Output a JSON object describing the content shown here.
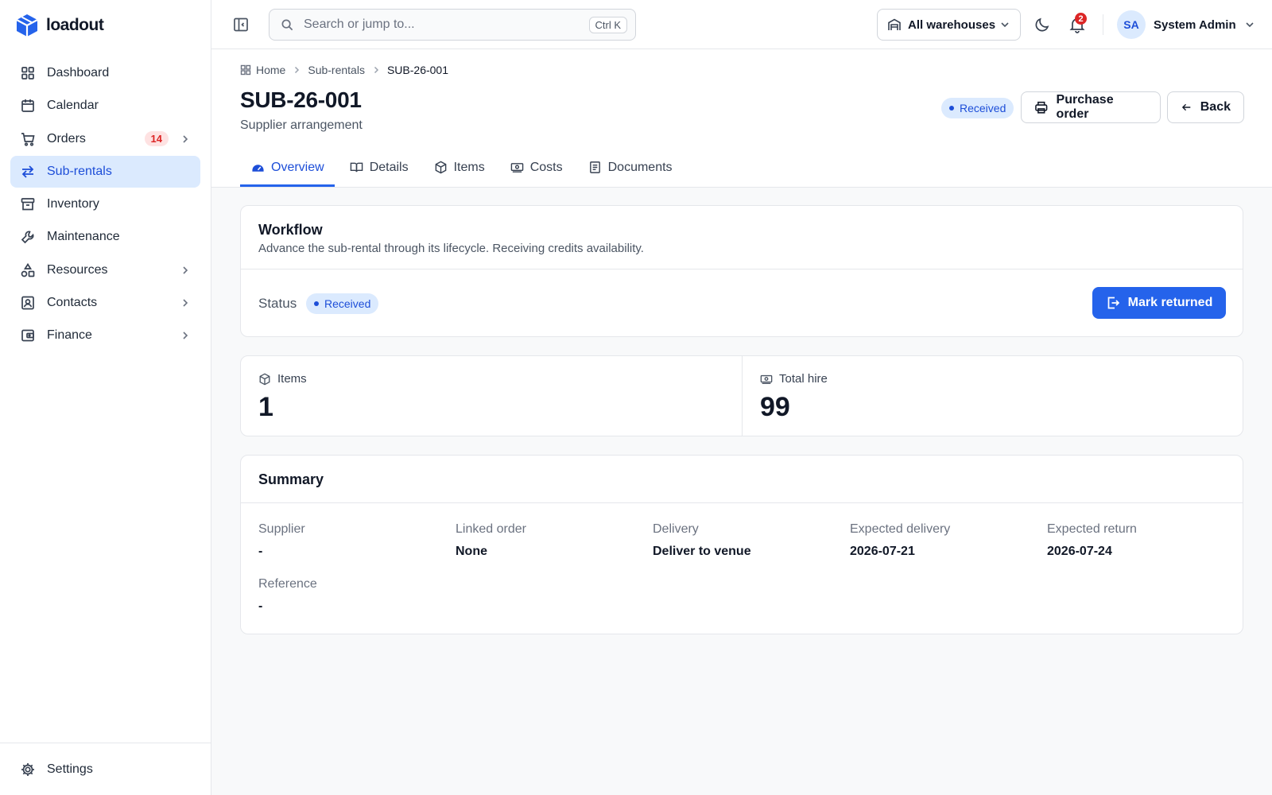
{
  "brand": {
    "name": "loadout"
  },
  "sidebar": {
    "items": [
      {
        "label": "Dashboard",
        "icon": "grid-icon"
      },
      {
        "label": "Calendar",
        "icon": "calendar-icon"
      },
      {
        "label": "Orders",
        "icon": "cart-icon",
        "badge": "14"
      },
      {
        "label": "Sub-rentals",
        "icon": "arrows-exchange-icon",
        "active": true
      },
      {
        "label": "Inventory",
        "icon": "archive-icon"
      },
      {
        "label": "Maintenance",
        "icon": "wrench-icon"
      },
      {
        "label": "Resources",
        "icon": "shapes-icon"
      },
      {
        "label": "Contacts",
        "icon": "contact-card-icon"
      },
      {
        "label": "Finance",
        "icon": "wallet-icon"
      }
    ],
    "footer": {
      "label": "Settings",
      "icon": "gear-icon"
    }
  },
  "topbar": {
    "search": {
      "placeholder": "Search or jump to...",
      "shortcut": "Ctrl K"
    },
    "warehouse": "All warehouses",
    "notifications_count": "2",
    "user": {
      "initials": "SA",
      "name": "System Admin"
    }
  },
  "breadcrumb": [
    "Home",
    "Sub-rentals",
    "SUB-26-001"
  ],
  "page": {
    "title": "SUB-26-001",
    "subtitle": "Supplier arrangement",
    "status": "Received",
    "actions": {
      "purchase_order": "Purchase order",
      "back": "Back"
    }
  },
  "tabs": [
    "Overview",
    "Details",
    "Items",
    "Costs",
    "Documents"
  ],
  "workflow": {
    "title": "Workflow",
    "description": "Advance the sub-rental through its lifecycle. Receiving credits availability.",
    "status_label": "Status",
    "status": "Received",
    "action": "Mark returned"
  },
  "stats": {
    "items": {
      "label": "Items",
      "value": "1"
    },
    "total_hire": {
      "label": "Total hire",
      "value": "99"
    }
  },
  "summary": {
    "title": "Summary",
    "fields": {
      "supplier": {
        "label": "Supplier",
        "value": "-"
      },
      "linked_order": {
        "label": "Linked order",
        "value": "None"
      },
      "delivery": {
        "label": "Delivery",
        "value": "Deliver to venue"
      },
      "expected_delivery": {
        "label": "Expected delivery",
        "value": "2026-07-21"
      },
      "expected_return": {
        "label": "Expected return",
        "value": "2026-07-24"
      },
      "reference": {
        "label": "Reference",
        "value": "-"
      }
    }
  },
  "colors": {
    "accent": "#2563eb",
    "active_bg": "#dbeafe",
    "badge_bg": "#fee2e2",
    "badge_text": "#dc2626"
  }
}
